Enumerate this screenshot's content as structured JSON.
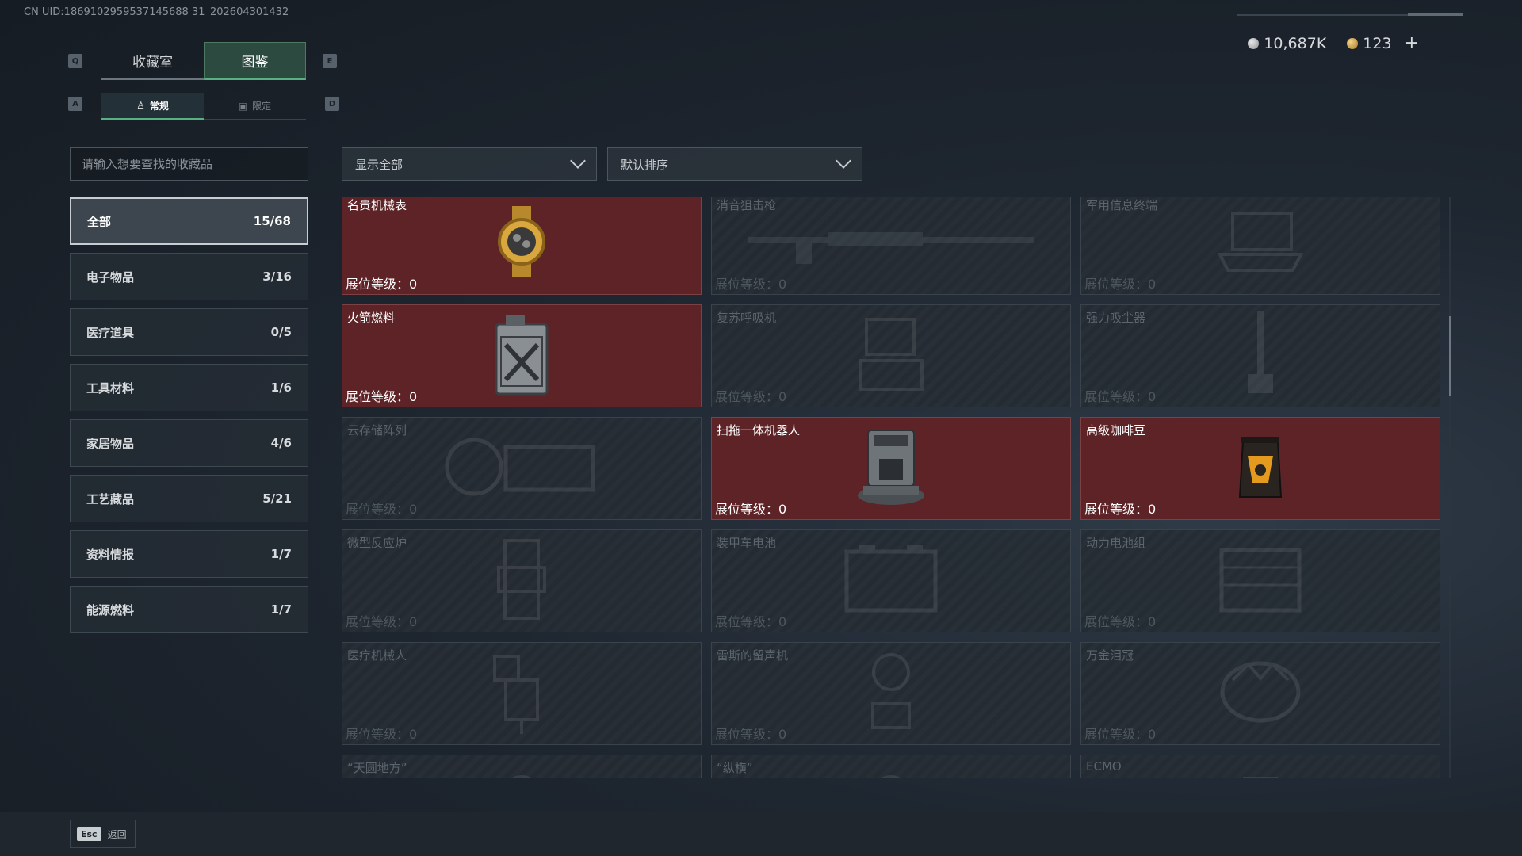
{
  "uid_text": "CN UID:1869102959537145688 31_202604301432",
  "currency": {
    "silver_value": "10,687K",
    "gold_value": "123",
    "plus_label": "+"
  },
  "keys": {
    "left_tab": "Q",
    "right_tab": "E",
    "left_sub": "A",
    "right_sub": "D"
  },
  "tabs": [
    {
      "label": "收藏室",
      "active": false
    },
    {
      "label": "图鉴",
      "active": true
    }
  ],
  "subtabs": [
    {
      "label": "常规",
      "icon": "person-icon",
      "active": true
    },
    {
      "label": "限定",
      "icon": "frame-icon",
      "active": false
    }
  ],
  "search": {
    "placeholder": "请输入想要查找的收藏品"
  },
  "categories": [
    {
      "label": "全部",
      "count": "15/68",
      "active": true
    },
    {
      "label": "电子物品",
      "count": "3/16"
    },
    {
      "label": "医疗道具",
      "count": "0/5"
    },
    {
      "label": "工具材料",
      "count": "1/6"
    },
    {
      "label": "家居物品",
      "count": "4/6"
    },
    {
      "label": "工艺藏品",
      "count": "5/21"
    },
    {
      "label": "资料情报",
      "count": "1/7"
    },
    {
      "label": "能源燃料",
      "count": "1/7"
    }
  ],
  "filters": {
    "show": "显示全部",
    "sort": "默认排序"
  },
  "level_label": "展位等级：",
  "items": [
    {
      "name": "名贵机械表",
      "level": "0",
      "owned": true,
      "icon": "watch-icon"
    },
    {
      "name": "消音狙击枪",
      "level": "0",
      "owned": false,
      "icon": "rifle-icon"
    },
    {
      "name": "军用信息终端",
      "level": "0",
      "owned": false,
      "icon": "laptop-icon"
    },
    {
      "name": "火箭燃料",
      "level": "0",
      "owned": true,
      "icon": "fuel-can-icon"
    },
    {
      "name": "复苏呼吸机",
      "level": "0",
      "owned": false,
      "icon": "ventilator-icon"
    },
    {
      "name": "强力吸尘器",
      "level": "0",
      "owned": false,
      "icon": "vacuum-icon"
    },
    {
      "name": "云存储阵列",
      "level": "0",
      "owned": false,
      "icon": "storage-array-icon"
    },
    {
      "name": "扫拖一体机器人",
      "level": "0",
      "owned": true,
      "icon": "robot-vacuum-icon"
    },
    {
      "name": "高级咖啡豆",
      "level": "0",
      "owned": true,
      "icon": "coffee-bag-icon"
    },
    {
      "name": "微型反应炉",
      "level": "0",
      "owned": false,
      "icon": "reactor-icon"
    },
    {
      "name": "装甲车电池",
      "level": "0",
      "owned": false,
      "icon": "battery-icon"
    },
    {
      "name": "动力电池组",
      "level": "0",
      "owned": false,
      "icon": "battery-pack-icon"
    },
    {
      "name": "医疗机械人",
      "level": "0",
      "owned": false,
      "icon": "medical-robot-icon"
    },
    {
      "name": "雷斯的留声机",
      "level": "0",
      "owned": false,
      "icon": "gramophone-icon"
    },
    {
      "name": "万金泪冠",
      "level": "0",
      "owned": false,
      "icon": "crown-icon"
    },
    {
      "name": "“天圆地方”",
      "level": "",
      "owned": false,
      "icon": "artifact-icon"
    },
    {
      "name": "“纵横”",
      "level": "",
      "owned": false,
      "icon": "artifact-icon"
    },
    {
      "name": "ECMO",
      "level": "",
      "owned": false,
      "icon": "ecmo-icon"
    }
  ],
  "footer": {
    "esc_key": "Esc",
    "back_label": "返回"
  }
}
